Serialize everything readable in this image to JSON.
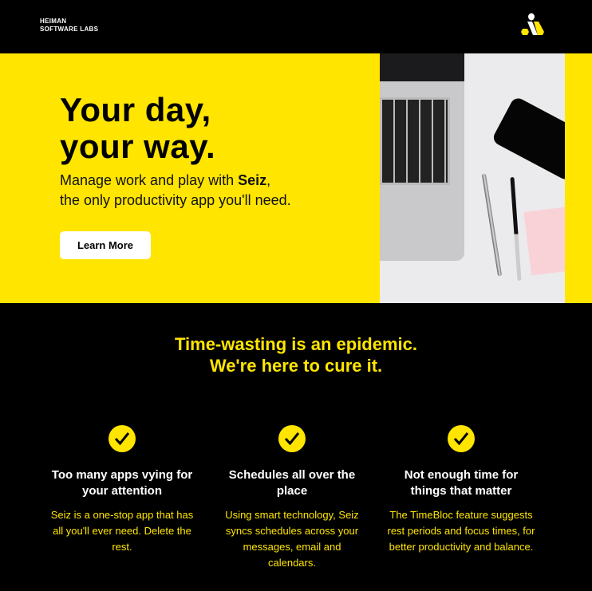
{
  "header": {
    "brand_line1": "HEIMAN",
    "brand_line2": "SOFTWARE LABS",
    "logo_icon": "heiman-logo-icon"
  },
  "hero": {
    "title_line1": "Your day,",
    "title_line2": "your way.",
    "subtitle_pre": "Manage work and play with ",
    "subtitle_brand": "Seiz",
    "subtitle_post": ",",
    "subtitle_line2": "the only productivity app you'll need.",
    "button": "Learn More"
  },
  "tagline": {
    "line1": "Time-wasting is an epidemic.",
    "line2": "We're here to cure it."
  },
  "features": [
    {
      "title": "Too many apps vying for your attention",
      "text": "Seiz is a one-stop app that has all you'll ever need. Delete the rest."
    },
    {
      "title": "Schedules all over the place",
      "text": "Using smart technology, Seiz syncs schedules across your messages, email and calendars."
    },
    {
      "title": "Not enough time for things that matter",
      "text": "The TimeBloc feature suggests rest periods and focus times, for better productivity and balance."
    }
  ],
  "colors": {
    "accent": "#FFE500",
    "background": "#000000"
  }
}
